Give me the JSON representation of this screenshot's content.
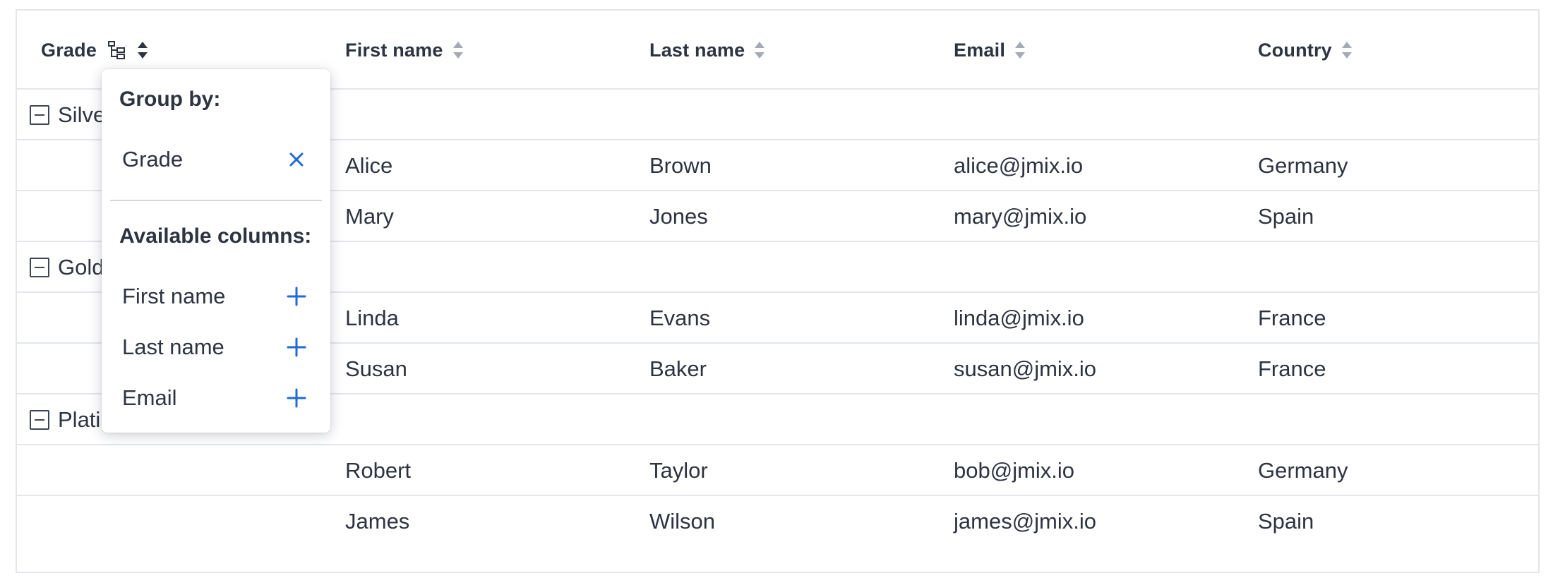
{
  "columns": {
    "grade": "Grade",
    "first_name": "First name",
    "last_name": "Last name",
    "email": "Email",
    "country": "Country"
  },
  "groups": [
    {
      "label": "Silver (2)",
      "rows": [
        {
          "first_name": "Alice",
          "last_name": "Brown",
          "email": "alice@jmix.io",
          "country": "Germany"
        },
        {
          "first_name": "Mary",
          "last_name": "Jones",
          "email": "mary@jmix.io",
          "country": "Spain"
        }
      ]
    },
    {
      "label": "Gold (2)",
      "rows": [
        {
          "first_name": "Linda",
          "last_name": "Evans",
          "email": "linda@jmix.io",
          "country": "France"
        },
        {
          "first_name": "Susan",
          "last_name": "Baker",
          "email": "susan@jmix.io",
          "country": "France"
        }
      ]
    },
    {
      "label": "Platinum (2)",
      "rows": [
        {
          "first_name": "Robert",
          "last_name": "Taylor",
          "email": "bob@jmix.io",
          "country": "Germany"
        },
        {
          "first_name": "James",
          "last_name": "Wilson",
          "email": "james@jmix.io",
          "country": "Spain"
        }
      ]
    }
  ],
  "popup": {
    "group_by_heading": "Group by:",
    "grouped": [
      {
        "label": "Grade",
        "action_icon": "close-icon"
      }
    ],
    "available_heading": "Available columns:",
    "available": [
      {
        "label": "First name",
        "action_icon": "plus-icon"
      },
      {
        "label": "Last name",
        "action_icon": "plus-icon"
      },
      {
        "label": "Email",
        "action_icon": "plus-icon"
      }
    ]
  },
  "colors": {
    "accent": "#1f6ad6",
    "text": "#2c3442",
    "border": "#e3e6ea"
  }
}
